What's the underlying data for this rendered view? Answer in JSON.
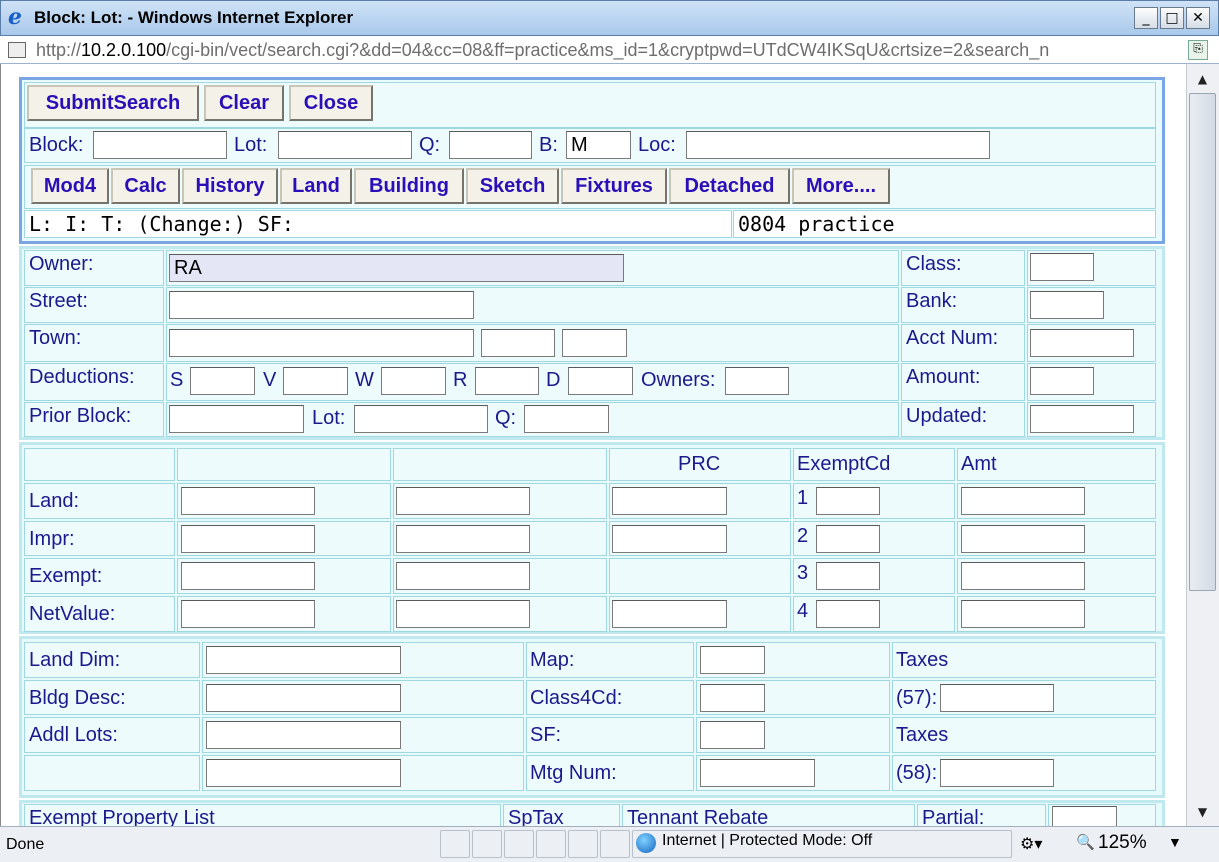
{
  "window": {
    "title": "Block: Lot: - Windows Internet Explorer",
    "minimize": "_",
    "maximize": "□",
    "close": "✕"
  },
  "address": {
    "prefix": "http://",
    "host": "10.2.0.100",
    "path": "/cgi-bin/vect/search.cgi?&dd=04&cc=08&ff=practice&ms_id=1&cryptpwd=UTdCW4IKSqU&crtsize=2&search_n"
  },
  "toolbar": {
    "submit": "SubmitSearch",
    "clear": "Clear",
    "close": "Close"
  },
  "search": {
    "block_label": "Block:",
    "block_value": "",
    "lot_label": "Lot:",
    "lot_value": "",
    "q_label": "Q:",
    "q_value": "",
    "b_label": "B:",
    "b_value": "M",
    "loc_label": "Loc:",
    "loc_value": ""
  },
  "nav": [
    "Mod4",
    "Calc",
    "History",
    "Land",
    "Building",
    "Sketch",
    "Fixtures",
    "Detached",
    "More...."
  ],
  "info_line": {
    "left": "L: I: T: (Change:) SF:",
    "right": "0804 practice"
  },
  "owner": {
    "owner_label": "Owner:",
    "owner_value": "RA",
    "street_label": "Street:",
    "town_label": "Town:",
    "deductions_label": "Deductions:",
    "ded_s": "S",
    "ded_v": "V",
    "ded_w": "W",
    "ded_r": "R",
    "ded_d": "D",
    "owners_label": "Owners:",
    "prior_block_label": "Prior Block:",
    "prior_lot_label": "Lot:",
    "prior_q_label": "Q:",
    "class_label": "Class:",
    "bank_label": "Bank:",
    "acct_label": "Acct Num:",
    "amount_label": "Amount:",
    "updated_label": "Updated:"
  },
  "values": {
    "prc_header": "PRC",
    "exempt_header": "ExemptCd",
    "amt_header": "Amt",
    "rows": [
      "Land:",
      "Impr:",
      "Exempt:",
      "NetValue:"
    ],
    "exempt_nums": [
      "1",
      "2",
      "3",
      "4"
    ]
  },
  "details": {
    "land_dim": "Land Dim:",
    "bldg_desc": "Bldg Desc:",
    "addl_lots": "Addl Lots:",
    "map": "Map:",
    "class4cd": "Class4Cd:",
    "sf": "SF:",
    "mtg_num": "Mtg Num:",
    "taxes1": "Taxes",
    "taxes57": "(57):",
    "taxes2": "Taxes",
    "taxes58": "(58):"
  },
  "bottom_row": {
    "exempt_list": "Exempt Property List",
    "sptax": "SpTax",
    "rebate": "Tennant Rebate",
    "partial": "Partial:"
  },
  "status": {
    "text": "Done",
    "zone": "Internet | Protected Mode: Off",
    "zoom": "125%"
  }
}
